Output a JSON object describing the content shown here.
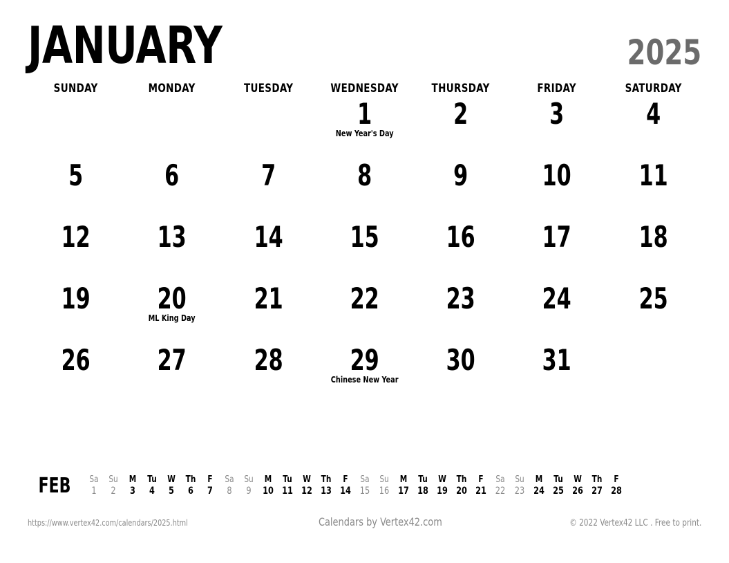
{
  "header": {
    "month": "JANUARY",
    "year": "2025"
  },
  "weekdays": [
    "SUNDAY",
    "MONDAY",
    "TUESDAY",
    "WEDNESDAY",
    "THURSDAY",
    "FRIDAY",
    "SATURDAY"
  ],
  "weeks": [
    [
      {
        "day": "",
        "event": ""
      },
      {
        "day": "",
        "event": ""
      },
      {
        "day": "",
        "event": ""
      },
      {
        "day": "1",
        "event": "New Year's Day"
      },
      {
        "day": "2",
        "event": ""
      },
      {
        "day": "3",
        "event": ""
      },
      {
        "day": "4",
        "event": ""
      }
    ],
    [
      {
        "day": "5",
        "event": ""
      },
      {
        "day": "6",
        "event": ""
      },
      {
        "day": "7",
        "event": ""
      },
      {
        "day": "8",
        "event": ""
      },
      {
        "day": "9",
        "event": ""
      },
      {
        "day": "10",
        "event": ""
      },
      {
        "day": "11",
        "event": ""
      }
    ],
    [
      {
        "day": "12",
        "event": ""
      },
      {
        "day": "13",
        "event": ""
      },
      {
        "day": "14",
        "event": ""
      },
      {
        "day": "15",
        "event": ""
      },
      {
        "day": "16",
        "event": ""
      },
      {
        "day": "17",
        "event": ""
      },
      {
        "day": "18",
        "event": ""
      }
    ],
    [
      {
        "day": "19",
        "event": ""
      },
      {
        "day": "20",
        "event": "ML King Day"
      },
      {
        "day": "21",
        "event": ""
      },
      {
        "day": "22",
        "event": ""
      },
      {
        "day": "23",
        "event": ""
      },
      {
        "day": "24",
        "event": ""
      },
      {
        "day": "25",
        "event": ""
      }
    ],
    [
      {
        "day": "26",
        "event": ""
      },
      {
        "day": "27",
        "event": ""
      },
      {
        "day": "28",
        "event": ""
      },
      {
        "day": "29",
        "event": "Chinese New Year"
      },
      {
        "day": "30",
        "event": ""
      },
      {
        "day": "31",
        "event": ""
      },
      {
        "day": "",
        "event": ""
      }
    ]
  ],
  "mini_strip": {
    "label": "FEB",
    "days": [
      {
        "dow": "Sa",
        "date": "1",
        "weekend": true
      },
      {
        "dow": "Su",
        "date": "2",
        "weekend": true
      },
      {
        "dow": "M",
        "date": "3",
        "weekend": false
      },
      {
        "dow": "Tu",
        "date": "4",
        "weekend": false
      },
      {
        "dow": "W",
        "date": "5",
        "weekend": false
      },
      {
        "dow": "Th",
        "date": "6",
        "weekend": false
      },
      {
        "dow": "F",
        "date": "7",
        "weekend": false
      },
      {
        "dow": "Sa",
        "date": "8",
        "weekend": true
      },
      {
        "dow": "Su",
        "date": "9",
        "weekend": true
      },
      {
        "dow": "M",
        "date": "10",
        "weekend": false
      },
      {
        "dow": "Tu",
        "date": "11",
        "weekend": false
      },
      {
        "dow": "W",
        "date": "12",
        "weekend": false
      },
      {
        "dow": "Th",
        "date": "13",
        "weekend": false
      },
      {
        "dow": "F",
        "date": "14",
        "weekend": false
      },
      {
        "dow": "Sa",
        "date": "15",
        "weekend": true
      },
      {
        "dow": "Su",
        "date": "16",
        "weekend": true
      },
      {
        "dow": "M",
        "date": "17",
        "weekend": false
      },
      {
        "dow": "Tu",
        "date": "18",
        "weekend": false
      },
      {
        "dow": "W",
        "date": "19",
        "weekend": false
      },
      {
        "dow": "Th",
        "date": "20",
        "weekend": false
      },
      {
        "dow": "F",
        "date": "21",
        "weekend": false
      },
      {
        "dow": "Sa",
        "date": "22",
        "weekend": true
      },
      {
        "dow": "Su",
        "date": "23",
        "weekend": true
      },
      {
        "dow": "M",
        "date": "24",
        "weekend": false
      },
      {
        "dow": "Tu",
        "date": "25",
        "weekend": false
      },
      {
        "dow": "W",
        "date": "26",
        "weekend": false
      },
      {
        "dow": "Th",
        "date": "27",
        "weekend": false
      },
      {
        "dow": "F",
        "date": "28",
        "weekend": false
      }
    ]
  },
  "footer": {
    "url": "https://www.vertex42.com/calendars/2025.html",
    "center": "Calendars by Vertex42.com",
    "copyright": "© 2022 Vertex42 LLC . Free to print."
  },
  "colors": {
    "text": "#000000",
    "muted": "#8a8a8a",
    "year": "#6b6b6b",
    "background": "#ffffff"
  }
}
